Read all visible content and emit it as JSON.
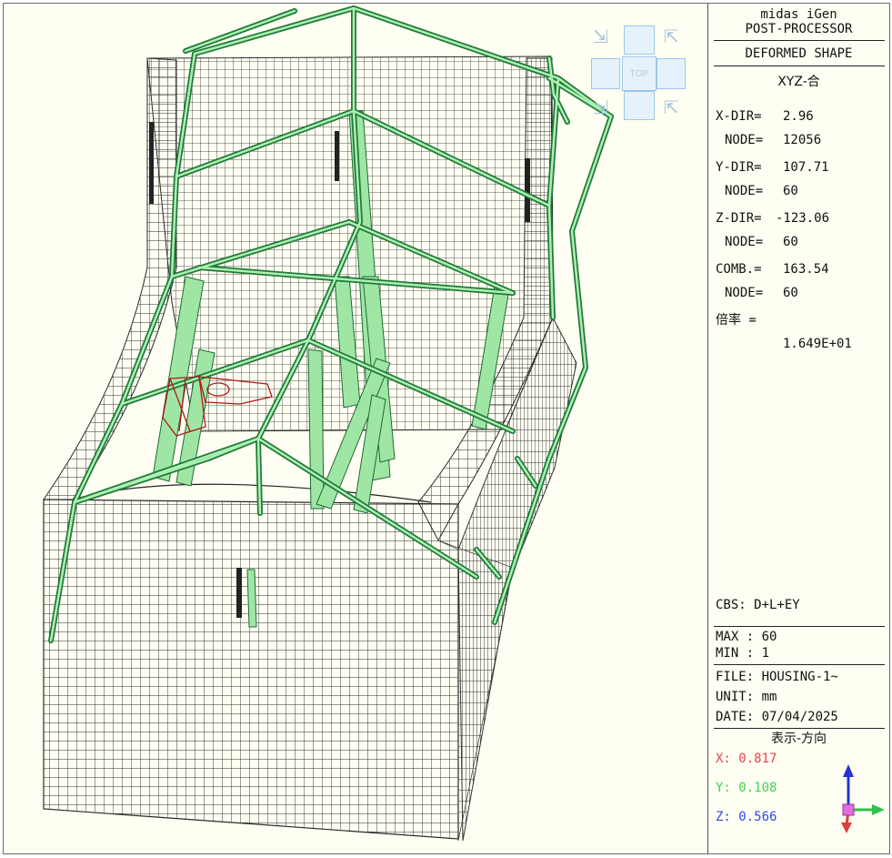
{
  "panel": {
    "app_name": "midas iGen",
    "module": "POST-PROCESSOR",
    "result_type": "DEFORMED SHAPE",
    "component": "XYZ-合",
    "x_dir_label": "X-DIR=",
    "x_dir_value": "2.96",
    "x_node_label": "NODE=",
    "x_node_value": "12056",
    "y_dir_label": "Y-DIR=",
    "y_dir_value": "107.71",
    "y_node_label": "NODE=",
    "y_node_value": "60",
    "z_dir_label": "Z-DIR=",
    "z_dir_value": "-123.06",
    "z_node_label": "NODE=",
    "z_node_value": "60",
    "comb_label": "COMB.=",
    "comb_value": "163.54",
    "comb_node_label": "NODE=",
    "comb_node_value": "60",
    "scale_label": "倍率 =",
    "scale_value": "1.649E+01",
    "cbs": "CBS: D+L+EY",
    "max": "MAX : 60",
    "min": "MIN : 1",
    "file": "FILE: HOUSING-1~",
    "unit": "UNIT: mm",
    "date": "DATE: 07/04/2025",
    "view_direction_title": "表示-方向",
    "view_x": "X: 0.817",
    "view_y": "Y: 0.108",
    "view_z": "Z: 0.566"
  },
  "nav_cube": {
    "top_label": "TOP"
  },
  "colors": {
    "background": "#fffef2",
    "mesh_line": "#2a2a2a",
    "frame_dark_green": "#1f7a3a",
    "frame_light_green": "#9fe6a5",
    "highlight_red": "#b01818",
    "axis_x": "#e2474a",
    "axis_y": "#3fcf51",
    "axis_z": "#3348e0"
  }
}
